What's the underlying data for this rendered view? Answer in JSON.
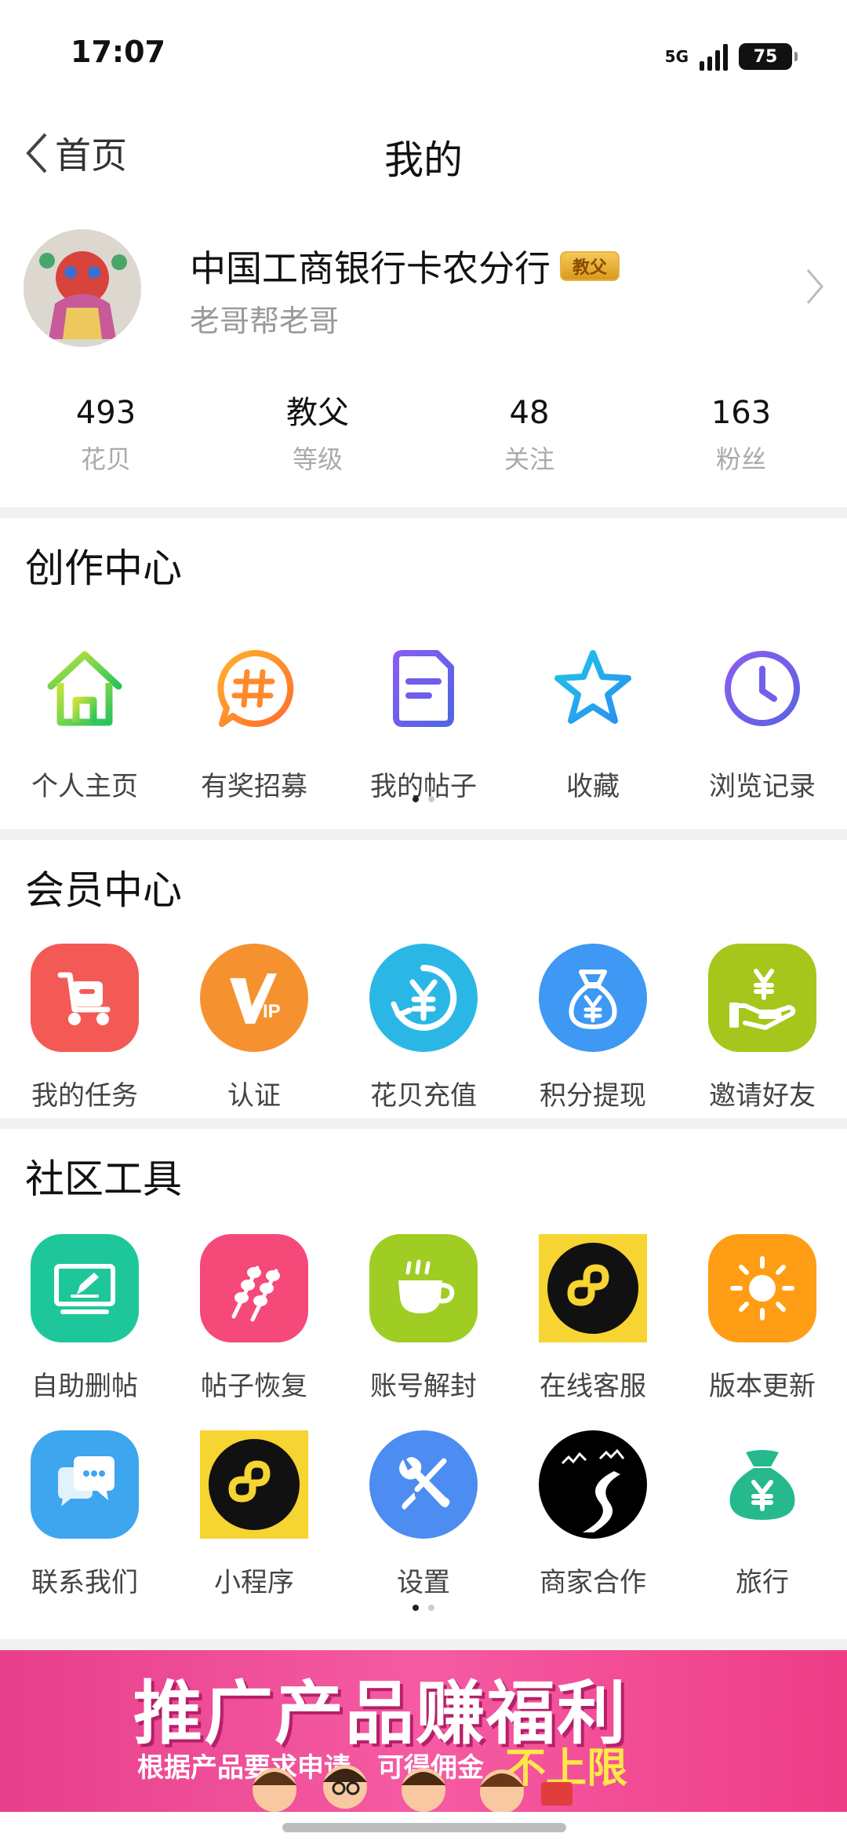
{
  "status_bar": {
    "time": "17:07",
    "network": "5G",
    "battery": "75"
  },
  "nav": {
    "back_label": "首页",
    "title": "我的"
  },
  "profile": {
    "name": "中国工商银行卡农分行",
    "badge": "教父",
    "subtitle": "老哥帮老哥"
  },
  "stats": [
    {
      "value": "493",
      "label": "花贝"
    },
    {
      "value": "教父",
      "label": "等级"
    },
    {
      "value": "48",
      "label": "关注"
    },
    {
      "value": "163",
      "label": "粉丝"
    }
  ],
  "creation_center": {
    "title": "创作中心",
    "items": [
      {
        "label": "个人主页",
        "icon": "home-icon"
      },
      {
        "label": "有奖招募",
        "icon": "hashtag-icon"
      },
      {
        "label": "我的帖子",
        "icon": "document-icon"
      },
      {
        "label": "收藏",
        "icon": "star-icon"
      },
      {
        "label": "浏览记录",
        "icon": "clock-icon"
      }
    ],
    "page": 1,
    "pages": 2
  },
  "member_center": {
    "title": "会员中心",
    "items": [
      {
        "label": "我的任务",
        "icon": "task-scooter-icon",
        "color": "#f45a55"
      },
      {
        "label": "认证",
        "icon": "vip-icon",
        "color": "#f5922f"
      },
      {
        "label": "花贝充值",
        "icon": "yuan-recharge-icon",
        "color": "#2bb7e5"
      },
      {
        "label": "积分提现",
        "icon": "money-bag-icon",
        "color": "#3e98f4"
      },
      {
        "label": "邀请好友",
        "icon": "hand-money-icon",
        "color": "#a6c61b"
      }
    ]
  },
  "community_tools": {
    "title": "社区工具",
    "row1": [
      {
        "label": "自助删帖",
        "icon": "monitor-edit-icon",
        "color": "#1ec79a"
      },
      {
        "label": "帖子恢复",
        "icon": "skewer-icon",
        "color": "#f5497a"
      },
      {
        "label": "账号解封",
        "icon": "coffee-cup-icon",
        "color": "#9fcd23"
      },
      {
        "label": "在线客服",
        "icon": "mini-program-icon",
        "color": "#f6d432"
      },
      {
        "label": "版本更新",
        "icon": "sun-icon",
        "color": "#ff9d14"
      }
    ],
    "row2": [
      {
        "label": "联系我们",
        "icon": "chat-bubbles-icon",
        "color": "#3ea5ef"
      },
      {
        "label": "小程序",
        "icon": "mini-program-icon",
        "color": "#f6d432"
      },
      {
        "label": "设置",
        "icon": "wrench-screwdriver-icon",
        "color": "#4d8cf0"
      },
      {
        "label": "商家合作",
        "icon": "road-landscape-icon",
        "color": "#000000"
      },
      {
        "label": "旅行",
        "icon": "money-bag-icon",
        "color": "#25b98d"
      }
    ],
    "page": 1,
    "pages": 2
  },
  "banner": {
    "title": "推广产品赚福利",
    "subtitle": "根据产品要求申请，可得佣金",
    "highlight": "不上限"
  }
}
